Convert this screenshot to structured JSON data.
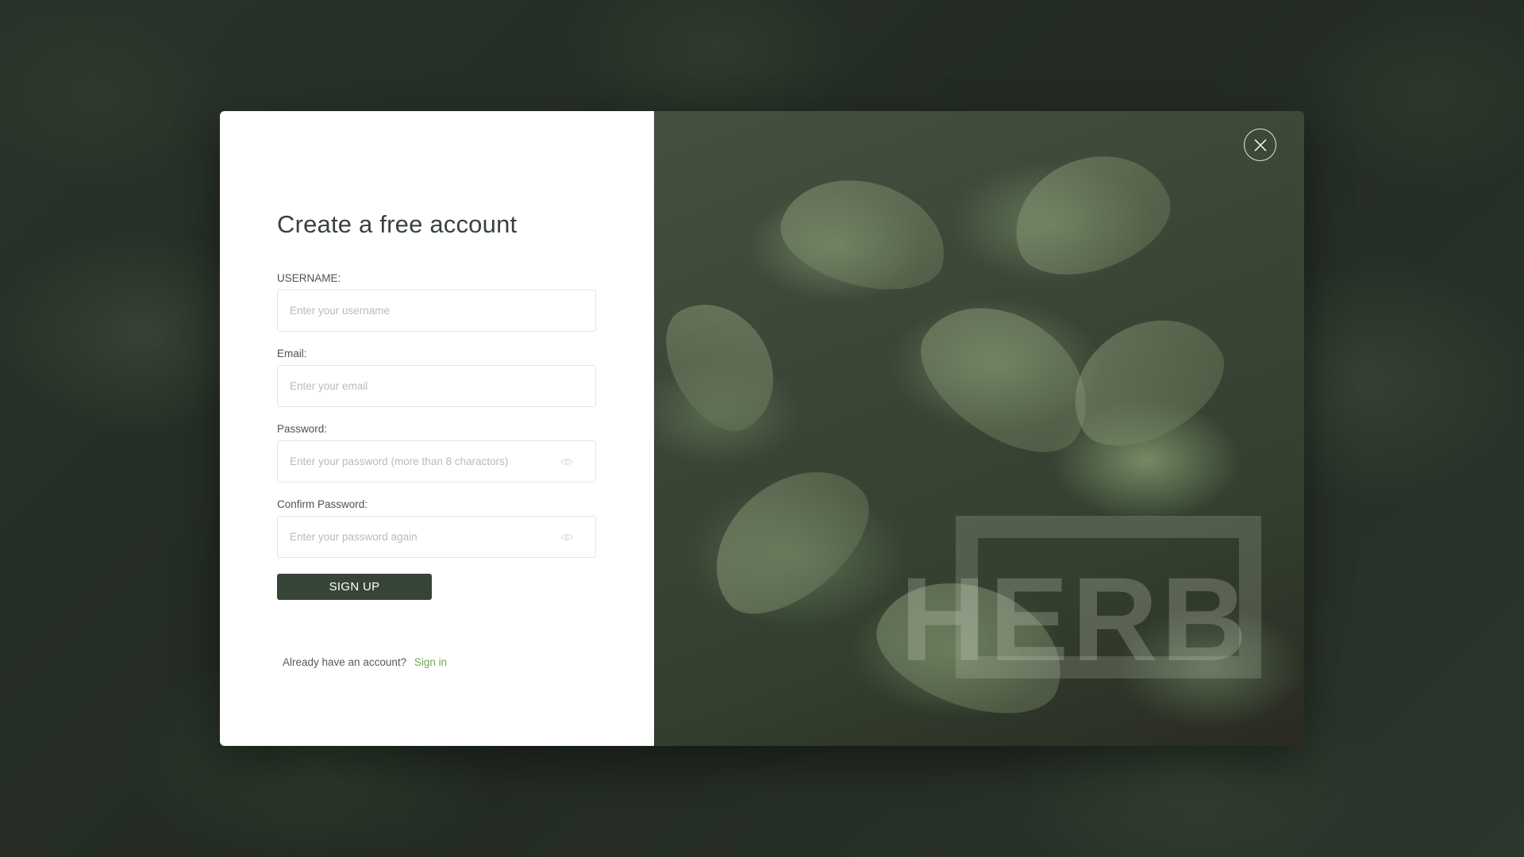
{
  "form": {
    "title": "Create a free account",
    "fields": [
      {
        "label": "USERNAME:",
        "placeholder": "Enter your username",
        "type": "text"
      },
      {
        "label": "Email:",
        "placeholder": "Enter your email",
        "type": "email"
      },
      {
        "label": "Password:",
        "placeholder": "Enter your password (more than 8 charactors)",
        "type": "password",
        "icon": "eye-icon"
      },
      {
        "label": "Confirm Password:",
        "placeholder": "Enter your password again",
        "type": "password",
        "icon": "eye-icon"
      }
    ],
    "submit_label": "SIGN UP",
    "footer_text": "Already have an account?",
    "footer_link": "Sign in"
  },
  "image_panel": {
    "logo_text": "HERB",
    "close_icon": "close-icon"
  },
  "colors": {
    "accent": "#374537",
    "link": "#69a859",
    "title": "#38433a"
  }
}
